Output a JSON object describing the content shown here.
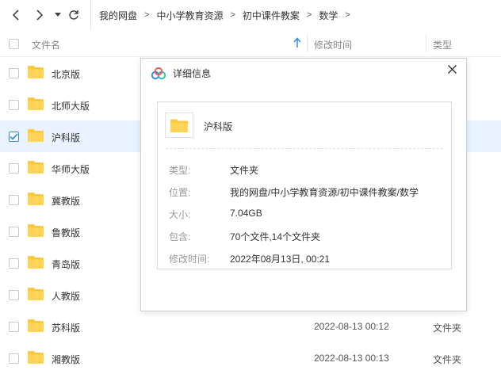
{
  "nav": {
    "back_icon": "chevron-left-icon",
    "forward_icon": "chevron-right-icon",
    "history_icon": "dropdown-arrow-icon",
    "refresh_icon": "refresh-icon"
  },
  "breadcrumb": [
    "我的网盘",
    "中小学教育资源",
    "初中课件教案",
    "数学"
  ],
  "breadcrumb_separator": ">",
  "columns": {
    "name": "文件名",
    "modified": "修改时间",
    "type": "类型"
  },
  "rows": [
    {
      "name": "北京版",
      "time": "",
      "type": "",
      "checked": false
    },
    {
      "name": "北师大版",
      "time": "",
      "type": "",
      "checked": false
    },
    {
      "name": "沪科版",
      "time": "",
      "type": "",
      "checked": true
    },
    {
      "name": "华师大版",
      "time": "",
      "type": "",
      "checked": false
    },
    {
      "name": "冀教版",
      "time": "",
      "type": "",
      "checked": false
    },
    {
      "name": "鲁教版",
      "time": "",
      "type": "",
      "checked": false
    },
    {
      "name": "青岛版",
      "time": "",
      "type": "",
      "checked": false
    },
    {
      "name": "人教版",
      "time": "",
      "type": "",
      "checked": false
    },
    {
      "name": "苏科版",
      "time": "2022-08-13 00:12",
      "type": "文件夹",
      "checked": false
    },
    {
      "name": "湘教版",
      "time": "2022-08-13 00:13",
      "type": "文件夹",
      "checked": false
    }
  ],
  "dialog": {
    "title": "详细信息",
    "close_icon": "close-icon",
    "item_name": "沪科版",
    "fields": [
      {
        "label": "类型:",
        "value": "文件夹"
      },
      {
        "label": "位置:",
        "value": "我的网盘/中小学教育资源/初中课件教案/数学"
      },
      {
        "label": "大小:",
        "value": "7.04GB"
      },
      {
        "label": "包含:",
        "value": "70个文件,14个文件夹"
      },
      {
        "label": "修改时间:",
        "value": "2022年08月13日, 00:21"
      }
    ]
  },
  "colors": {
    "accent": "#2f8cf0",
    "folder": "#ffc93d",
    "selected_row": "#e8f3ff"
  }
}
